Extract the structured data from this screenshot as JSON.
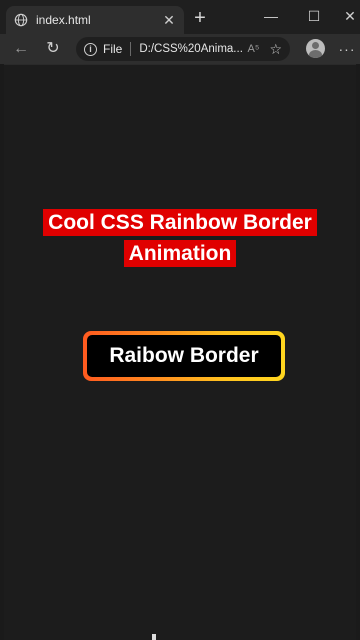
{
  "browser": {
    "tab_title": "index.html",
    "new_tab_symbol": "+",
    "file_label": "File",
    "url": "D:/CSS%20Anima...",
    "read_aloud_label": "A⁵"
  },
  "page": {
    "heading_line1": "Cool CSS Rainbow Border",
    "heading_line2": "Animation",
    "box_text": "Raibow Border"
  },
  "colors": {
    "heading_bg": "#e00000",
    "border_start": "#ff5a1f",
    "border_end": "#ffd61f",
    "page_bg": "#1c1c1c"
  },
  "icons": [
    "globe-icon",
    "close-icon",
    "plus-icon",
    "minimize-icon",
    "maximize-icon",
    "window-close-icon",
    "back-arrow-icon",
    "reload-icon",
    "info-icon",
    "read-aloud-icon",
    "favorite-star-icon",
    "profile-avatar-icon",
    "more-menu-icon"
  ]
}
